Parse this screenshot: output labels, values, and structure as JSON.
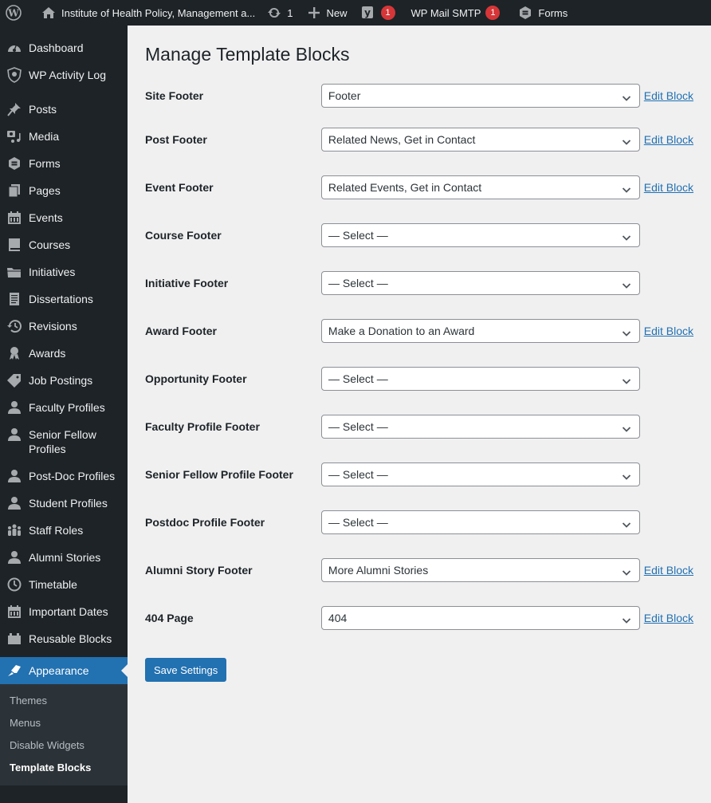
{
  "admin_bar": {
    "site_name": "Institute of Health Policy, Management a...",
    "updates_count": "1",
    "new_label": "New",
    "yoast_badge": "1",
    "smtp_label": "WP Mail SMTP",
    "smtp_badge": "1",
    "forms_label": "Forms"
  },
  "sidebar": {
    "items": [
      {
        "label": "Dashboard",
        "icon": "dashboard-icon"
      },
      {
        "label": "WP Activity Log",
        "icon": "shield-icon"
      },
      {
        "label": "Posts",
        "icon": "pin-icon"
      },
      {
        "label": "Media",
        "icon": "media-icon"
      },
      {
        "label": "Forms",
        "icon": "forms-icon"
      },
      {
        "label": "Pages",
        "icon": "pages-icon"
      },
      {
        "label": "Events",
        "icon": "calendar-icon"
      },
      {
        "label": "Courses",
        "icon": "book-icon"
      },
      {
        "label": "Initiatives",
        "icon": "folder-icon"
      },
      {
        "label": "Dissertations",
        "icon": "document-icon"
      },
      {
        "label": "Revisions",
        "icon": "history-icon"
      },
      {
        "label": "Awards",
        "icon": "award-icon"
      },
      {
        "label": "Job Postings",
        "icon": "tag-icon"
      },
      {
        "label": "Faculty Profiles",
        "icon": "user-icon"
      },
      {
        "label": "Senior Fellow Profiles",
        "icon": "user-icon"
      },
      {
        "label": "Post-Doc Profiles",
        "icon": "user-icon"
      },
      {
        "label": "Student Profiles",
        "icon": "user-icon"
      },
      {
        "label": "Staff Roles",
        "icon": "groups-icon"
      },
      {
        "label": "Alumni Stories",
        "icon": "user-icon"
      },
      {
        "label": "Timetable",
        "icon": "clock-icon"
      },
      {
        "label": "Important Dates",
        "icon": "calendar-icon"
      },
      {
        "label": "Reusable Blocks",
        "icon": "block-icon"
      }
    ],
    "current": {
      "label": "Appearance",
      "icon": "brush-icon"
    },
    "submenu": [
      "Themes",
      "Menus",
      "Disable Widgets",
      "Template Blocks"
    ],
    "submenu_current": "Template Blocks"
  },
  "main": {
    "title": "Manage Template Blocks",
    "edit_label": "Edit Block",
    "rows": [
      {
        "label": "Site Footer",
        "value": "Footer",
        "editable": true
      },
      {
        "label": "Post Footer",
        "value": "Related News, Get in Contact",
        "editable": true
      },
      {
        "label": "Event Footer",
        "value": "Related Events, Get in Contact",
        "editable": true
      },
      {
        "label": "Course Footer",
        "value": "— Select —",
        "editable": false
      },
      {
        "label": "Initiative Footer",
        "value": "— Select —",
        "editable": false
      },
      {
        "label": "Award Footer",
        "value": "Make a Donation to an Award",
        "editable": true
      },
      {
        "label": "Opportunity Footer",
        "value": "— Select —",
        "editable": false
      },
      {
        "label": "Faculty Profile Footer",
        "value": "— Select —",
        "editable": false
      },
      {
        "label": "Senior Fellow Profile Footer",
        "value": "— Select —",
        "editable": false
      },
      {
        "label": "Postdoc Profile Footer",
        "value": "— Select —",
        "editable": false
      },
      {
        "label": "Alumni Story Footer",
        "value": "More Alumni Stories",
        "editable": true
      },
      {
        "label": "404 Page",
        "value": "404",
        "editable": true
      }
    ],
    "save_label": "Save Settings"
  },
  "colors": {
    "accent": "#2271b1",
    "sidebar_bg": "#1d2327",
    "badge": "#d63638"
  }
}
